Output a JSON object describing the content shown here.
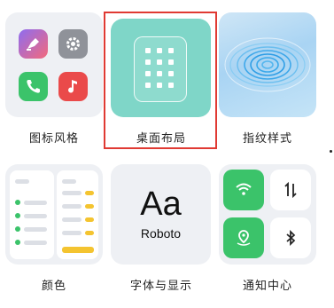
{
  "tiles": [
    {
      "label": "图标风格",
      "icon": "icon-style-preview"
    },
    {
      "label": "桌面布局",
      "icon": "desktop-layout-preview",
      "highlighted": true
    },
    {
      "label": "指纹样式",
      "icon": "fingerprint-preview"
    },
    {
      "label": "颜色",
      "icon": "color-preview"
    },
    {
      "label": "字体与显示",
      "icon": "font-preview"
    },
    {
      "label": "通知中心",
      "icon": "quick-settings-preview"
    }
  ],
  "font_preview": {
    "sample": "Aa",
    "name": "Roboto"
  },
  "colors": {
    "highlight": "#e03a33",
    "layout_teal": "#7fd6c8",
    "green": "#3bc36a",
    "yellow": "#f4c430"
  }
}
